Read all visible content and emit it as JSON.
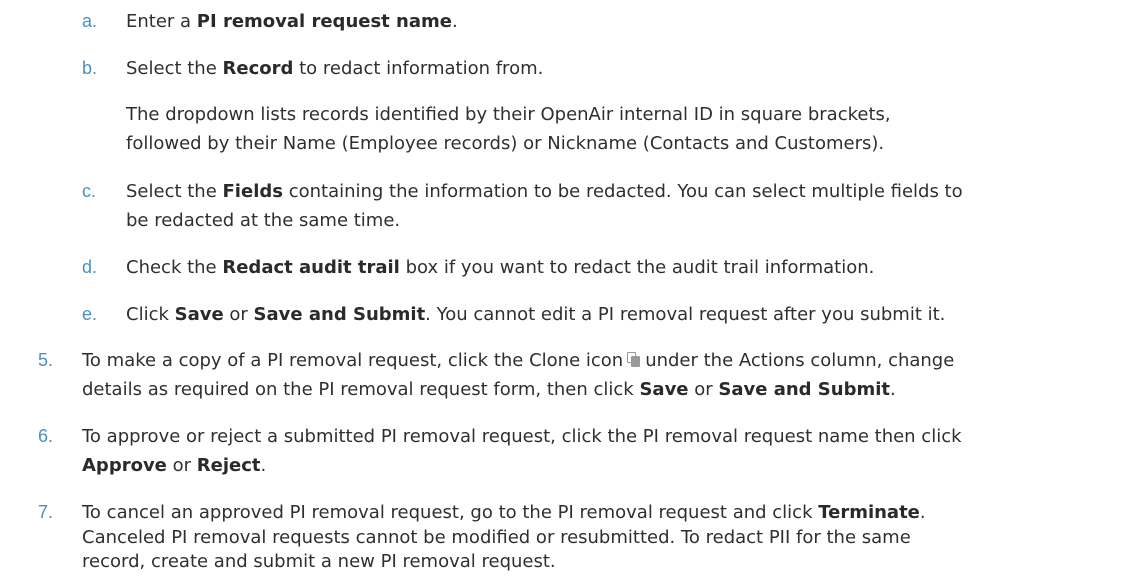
{
  "steps": {
    "a": {
      "marker": "a.",
      "t1": "Enter a ",
      "b1": "PI removal request name",
      "t2": "."
    },
    "b": {
      "marker": "b.",
      "t1": "Select the ",
      "b1": "Record",
      "t2": " to redact information from."
    },
    "b_note": {
      "line1": "The dropdown lists records identified by their OpenAir internal ID in square brackets,",
      "line2": "followed by their Name (Employee records) or Nickname (Contacts and Customers)."
    },
    "c": {
      "marker": "c.",
      "t1": "Select the ",
      "b1": "Fields",
      "t2": " containing the information to be redacted. You can select multiple fields to",
      "line2": "be redacted at the same time."
    },
    "d": {
      "marker": "d.",
      "t1": "Check the ",
      "b1": "Redact audit trail",
      "t2": " box if you want to redact the audit trail information."
    },
    "e": {
      "marker": "e.",
      "t1": "Click ",
      "b1": "Save",
      "t2": " or ",
      "b2": "Save and Submit",
      "t3": ". You cannot edit a PI removal request after you submit it."
    },
    "s5": {
      "marker": "5.",
      "t1": "To make a copy of a PI removal request, click the Clone icon",
      "icon": "clone-icon",
      "t2": "under the Actions column, change",
      "t3": "details as required on the PI removal request form, then click ",
      "b1": "Save",
      "t4": " or ",
      "b2": "Save and Submit",
      "t5": "."
    },
    "s6": {
      "marker": "6.",
      "t1": "To approve or reject a submitted PI removal request, click the PI removal request name then click",
      "b1": "Approve",
      "t2": " or ",
      "b2": "Reject",
      "t3": "."
    },
    "s7": {
      "marker": "7.",
      "t1": "To cancel an approved PI removal request, go to the PI removal request and click ",
      "b1": "Terminate",
      "t2": ".",
      "line2": "Canceled PI removal requests cannot be modified or resubmitted. To redact PII for the same",
      "line3": "record, create and submit a new PI removal request."
    }
  }
}
